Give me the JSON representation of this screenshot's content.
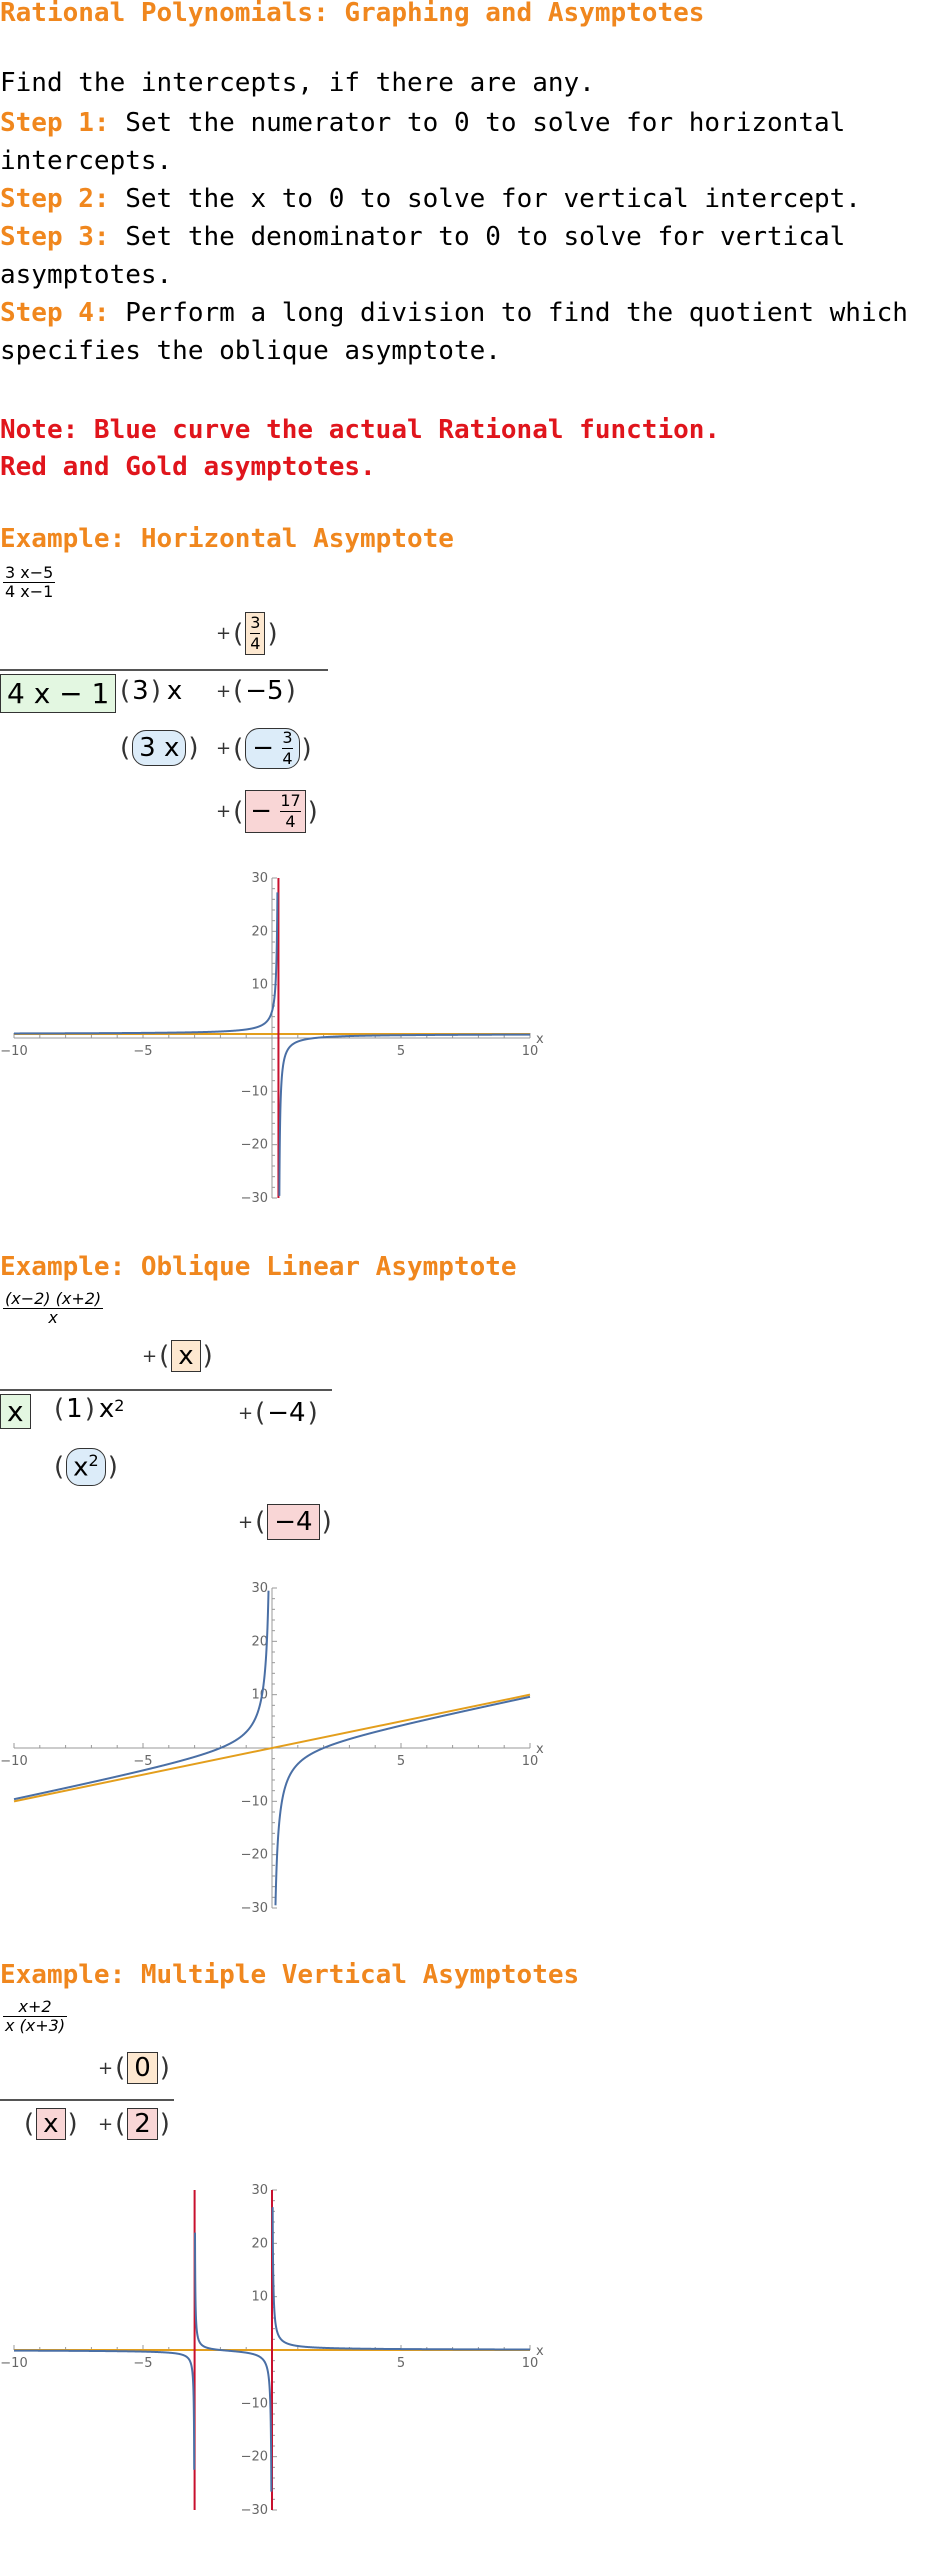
{
  "title": "Rational Polynomials: Graphing and Asymptotes",
  "intro": "Find the intercepts, if there are any.",
  "steps": [
    {
      "label": "Step 1:",
      "text": " Set the numerator to 0 to solve for horizontal intercepts."
    },
    {
      "label": "Step 2:",
      "text": " Set the x to 0 to solve for vertical intercept."
    },
    {
      "label": "Step 3:",
      "text": " Set the denominator to 0 to solve for vertical asymptotes."
    },
    {
      "label": "Step 4:",
      "text": " Perform a long division to find the quotient which specifies the oblique asymptote."
    }
  ],
  "note": {
    "line1": "Note: Blue curve the actual Rational function.",
    "line2": "Red and Gold asymptotes."
  },
  "examples": [
    {
      "title": "Example: Horizontal Asymptote",
      "expr_num": "3 x−5",
      "expr_den": "4 x−1",
      "quotient_sign": "+",
      "quotient_num": "3",
      "quotient_den": "4",
      "divisor": "4 x − 1",
      "dividend_coef": "3",
      "dividend_var": "x",
      "dividend_const_sign": "+",
      "dividend_const": "−5",
      "product_term": "3 x",
      "product_const_sign": "+",
      "product_const": "−",
      "product_const_num": "3",
      "product_const_den": "4",
      "remainder_sign": "+",
      "remainder_minus": "−",
      "remainder_num": "17",
      "remainder_den": "4"
    },
    {
      "title": "Example: Oblique Linear Asymptote",
      "expr_num": "(x−2) (x+2)",
      "expr_den": "x",
      "quotient_sign": "+",
      "quotient": "x",
      "divisor": "x",
      "dividend_coef": "1",
      "dividend_var": "x",
      "dividend_exp": "2",
      "dividend_const_sign": "+",
      "dividend_const": "−4",
      "product_term": "x",
      "product_exp": "2",
      "remainder_sign": "+",
      "remainder": "−4"
    },
    {
      "title": "Example: Multiple Vertical Asymptotes",
      "expr_num": "x+2",
      "expr_den": "x (x+3)",
      "quotient_sign": "+",
      "quotient": "0",
      "remainder_term": "x",
      "remainder_sign": "+",
      "remainder": "2"
    }
  ],
  "chart_data": [
    {
      "type": "line",
      "function": "(3x-5)/(4x-1)",
      "xlabel": "x",
      "xlim": [
        -10,
        10
      ],
      "ylim": [
        -30,
        30
      ],
      "xticks": [
        -10,
        -5,
        5,
        10
      ],
      "yticks": [
        -30,
        -20,
        -10,
        10,
        20,
        30
      ],
      "vertical_asymptotes": [
        0.25
      ],
      "horizontal_asymptote": 0.75,
      "colors": {
        "curve": "#4a6fa5",
        "vertical": "#c8102e",
        "asymptote": "#e39e1c"
      }
    },
    {
      "type": "line",
      "function": "(x-2)(x+2)/x",
      "xlabel": "x",
      "xlim": [
        -10,
        10
      ],
      "ylim": [
        -30,
        30
      ],
      "xticks": [
        -10,
        -5,
        5,
        10
      ],
      "yticks": [
        -30,
        -20,
        -10,
        10,
        20,
        30
      ],
      "oblique_asymptote": "y = x",
      "colors": {
        "curve": "#4a6fa5",
        "asymptote": "#e39e1c"
      }
    },
    {
      "type": "line",
      "function": "(x+2)/(x(x+3))",
      "xlabel": "x",
      "xlim": [
        -10,
        10
      ],
      "ylim": [
        -30,
        30
      ],
      "xticks": [
        -10,
        -5,
        5,
        10
      ],
      "yticks": [
        -30,
        -20,
        -10,
        10,
        20,
        30
      ],
      "vertical_asymptotes": [
        -3,
        0
      ],
      "horizontal_asymptote": 0,
      "colors": {
        "curve": "#4a6fa5",
        "vertical": "#c8102e",
        "asymptote": "#e39e1c"
      }
    }
  ]
}
